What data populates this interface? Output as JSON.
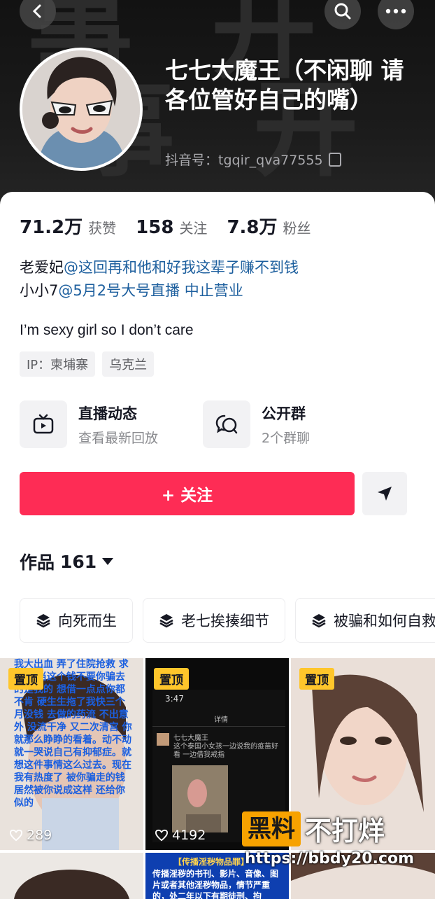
{
  "header": {
    "bg_glyphs": [
      "事 开",
      "事 开"
    ],
    "nickname": "七七大魔王（不闲聊 请各位管好自己的嘴）",
    "douyin_id": "抖音号：tgqir_qva77555"
  },
  "stats": [
    {
      "num": "71.2万",
      "label": "获赞"
    },
    {
      "num": "158",
      "label": "关注"
    },
    {
      "num": "7.8万",
      "label": "粉丝"
    }
  ],
  "bio": {
    "line1_prefix": "老爱妃",
    "line1_mention": "@这回再和他和好我这辈子赚不到钱",
    "line2_prefix": "小小7",
    "line2_mention": "@5月2号大号直播 中止营业",
    "tagline": "I’m sexy girl so I don’t care"
  },
  "tags": [
    "IP：柬埔寨",
    "乌克兰"
  ],
  "features": [
    {
      "title": "直播动态",
      "sub": "查看最新回放",
      "icon": "tv-icon"
    },
    {
      "title": "公开群",
      "sub": "2个群聊",
      "icon": "chat-bubbles-icon"
    }
  ],
  "follow_label": "+ 关注",
  "works": {
    "label": "作品",
    "count": "161"
  },
  "collections": [
    "向死而生",
    "老七挨揍细节",
    "被骗和如何自救"
  ],
  "videos": [
    {
      "pinned": "置顶",
      "likes": "289",
      "overlay_text": "我大出血 弄了住院抢救 求你 就当这个钱不要你骗去的是我的 想借一点点你都不肯 硬生生拖了我快三个月没钱 去做的药流 不出意外 没流干净 又二次清宫 你就那么睁睁的看着。动不动就一哭说自己有抑郁症。就想这件事情这么过去。现在我有热度了 被你骗走的钱 居然被你说成这样 还给你似的"
    },
    {
      "pinned": "置顶",
      "likes": "4192",
      "phone_time": "3:47",
      "phone_title": "详情",
      "phone_user": "七七大魔王",
      "phone_msg": "这个泰国小女孩一边说我的疫苗好看 一边借我戒指"
    },
    {
      "pinned": "置顶",
      "likes": ""
    }
  ],
  "row2_banner": "【传播淫秽物品罪】",
  "row2_text": "传播淫秽的书刊、影片、音像、图片或者其他淫秽物品，情节严重的，处二年以下有期徒刑、拘",
  "watermark": {
    "box": "黑料",
    "text": "不打烊",
    "url": "https://bbdy20.com"
  },
  "colors": {
    "accent": "#fe2c55",
    "pin": "#ffc62b",
    "mention": "#1d5f9e"
  }
}
